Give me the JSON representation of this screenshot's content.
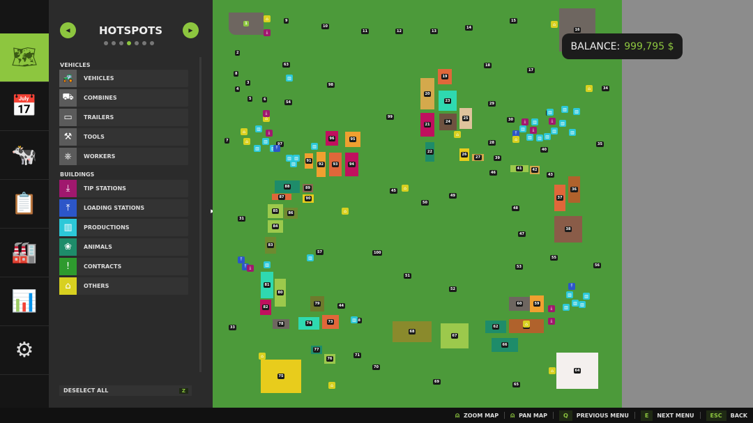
{
  "rail": {
    "items": [
      {
        "icon": "map-icon",
        "glyph": "🗺"
      },
      {
        "icon": "calendar-icon",
        "glyph": "📅"
      },
      {
        "icon": "cow-icon",
        "glyph": "🐄"
      },
      {
        "icon": "contracts-icon",
        "glyph": "📋"
      },
      {
        "icon": "production-icon",
        "glyph": "🏭"
      },
      {
        "icon": "statistics-icon",
        "glyph": "📊"
      },
      {
        "icon": "settings-icon",
        "glyph": "⚙"
      }
    ],
    "selected": 0
  },
  "panel": {
    "title": "HOTSPOTS",
    "page_count": 7,
    "current_page": 4,
    "vehicles_header": "VEHICLES",
    "vehicles": [
      {
        "label": "VEHICLES",
        "icon": "tractor-icon",
        "glyph": "🚜"
      },
      {
        "label": "COMBINES",
        "icon": "combine-icon",
        "glyph": "⛟"
      },
      {
        "label": "TRAILERS",
        "icon": "trailer-icon",
        "glyph": "▭"
      },
      {
        "label": "TOOLS",
        "icon": "tool-icon",
        "glyph": "⚒"
      },
      {
        "label": "WORKERS",
        "icon": "steering-wheel-icon",
        "glyph": "⎈"
      }
    ],
    "buildings_header": "BUILDINGS",
    "buildings": [
      {
        "label": "TIP STATIONS",
        "icon": "tip-station-icon",
        "glyph": "⤓",
        "color": "#a0186e"
      },
      {
        "label": "LOADING STATIONS",
        "icon": "loading-station-icon",
        "glyph": "⤒",
        "color": "#2c56c8"
      },
      {
        "label": "PRODUCTIONS",
        "icon": "factory-icon",
        "glyph": "▥",
        "color": "#2cc8d8"
      },
      {
        "label": "ANIMALS",
        "icon": "paw-icon",
        "glyph": "❀",
        "color": "#1e8c6a"
      },
      {
        "label": "CONTRACTS",
        "icon": "exclamation-icon",
        "glyph": "!",
        "color": "#2e9a2e"
      },
      {
        "label": "OTHERS",
        "icon": "house-icon",
        "glyph": "⌂",
        "color": "#d8d020"
      }
    ],
    "deselect_label": "DESELECT ALL",
    "deselect_key": "Z"
  },
  "balance": {
    "label": "BALANCE:",
    "value": "999,795 $"
  },
  "map": {
    "fields": [
      {
        "id": "1",
        "color": "#6e6660"
      },
      {
        "id": "16",
        "color": "#6e6660"
      },
      {
        "id": "19",
        "color": "#e0673a"
      },
      {
        "id": "20",
        "color": "#d4a94c"
      },
      {
        "id": "23",
        "color": "#2fd9b0"
      },
      {
        "id": "21",
        "color": "#c0105e"
      },
      {
        "id": "24",
        "color": "#6e5240"
      },
      {
        "id": "25",
        "color": "#dfc39c"
      },
      {
        "id": "22",
        "color": "#1e8c6a"
      },
      {
        "id": "26",
        "color": "#e8cc1c"
      },
      {
        "id": "27",
        "color": "#d4a94c"
      },
      {
        "id": "41",
        "color": "#9cc94c"
      },
      {
        "id": "42",
        "color": "#d4a94c"
      },
      {
        "id": "36",
        "color": "#b0622c"
      },
      {
        "id": "37",
        "color": "#e0673a"
      },
      {
        "id": "38",
        "color": "#8a5c48"
      },
      {
        "id": "96",
        "color": "#c0105e"
      },
      {
        "id": "95",
        "color": "#f0a030"
      },
      {
        "id": "91",
        "color": "#f0a030"
      },
      {
        "id": "92",
        "color": "#f0a030"
      },
      {
        "id": "93",
        "color": "#e0673a"
      },
      {
        "id": "94",
        "color": "#c0105e"
      },
      {
        "id": "88",
        "color": "#1e8c6a"
      },
      {
        "id": "87",
        "color": "#e0673a"
      },
      {
        "id": "89",
        "color": "#8a6a50"
      },
      {
        "id": "90",
        "color": "#e8cc1c"
      },
      {
        "id": "85",
        "color": "#9cc94c"
      },
      {
        "id": "86",
        "color": "#6e8a30"
      },
      {
        "id": "84",
        "color": "#9cc94c"
      },
      {
        "id": "83",
        "color": "#6e8a30"
      },
      {
        "id": "81",
        "color": "#2fd9b0"
      },
      {
        "id": "80",
        "color": "#9cc94c"
      },
      {
        "id": "82",
        "color": "#c0105e"
      },
      {
        "id": "79",
        "color": "#6e7a2c"
      },
      {
        "id": "78",
        "color": "#6e6660"
      },
      {
        "id": "74",
        "color": "#2fd9b0"
      },
      {
        "id": "73",
        "color": "#e0673a"
      },
      {
        "id": "77",
        "color": "#1e8c6a"
      },
      {
        "id": "76",
        "color": "#9cc94c"
      },
      {
        "id": "75",
        "color": "#e8cc1c"
      },
      {
        "id": "68",
        "color": "#8a8a2c"
      },
      {
        "id": "67",
        "color": "#9cc94c"
      },
      {
        "id": "60",
        "color": "#6e6660"
      },
      {
        "id": "59",
        "color": "#f0a030"
      },
      {
        "id": "62",
        "color": "#1e8c6a"
      },
      {
        "id": "61",
        "color": "#b0622c"
      },
      {
        "id": "66",
        "color": "#1e8c6a"
      },
      {
        "id": "64",
        "color": "#f4f0ee"
      }
    ],
    "markers": [
      "9",
      "10",
      "11",
      "12",
      "13",
      "14",
      "15",
      "2",
      "63",
      "8",
      "3",
      "98",
      "4",
      "5",
      "6",
      "54",
      "18",
      "17",
      "34",
      "29",
      "30",
      "35",
      "99",
      "7",
      "97",
      "28",
      "39",
      "40",
      "46",
      "43",
      "45",
      "49",
      "50",
      "48",
      "31",
      "47",
      "57",
      "100",
      "53",
      "55",
      "56",
      "51",
      "52",
      "44",
      "33",
      "58",
      "71",
      "70",
      "69",
      "65",
      "32"
    ],
    "icon_colors": {
      "production": "#2cc8d8",
      "tip": "#a0186e",
      "other": "#d8d020",
      "loading": "#2c56c8"
    }
  },
  "bottombar": {
    "hints": [
      {
        "key": "",
        "icon": "mouse-icon",
        "label": "ZOOM MAP"
      },
      {
        "key": "",
        "icon": "mouse-pan-icon",
        "label": "PAN MAP"
      },
      {
        "key": "Q",
        "label": "PREVIOUS MENU"
      },
      {
        "key": "E",
        "label": "NEXT MENU"
      },
      {
        "key": "ESC",
        "label": "BACK"
      }
    ]
  }
}
